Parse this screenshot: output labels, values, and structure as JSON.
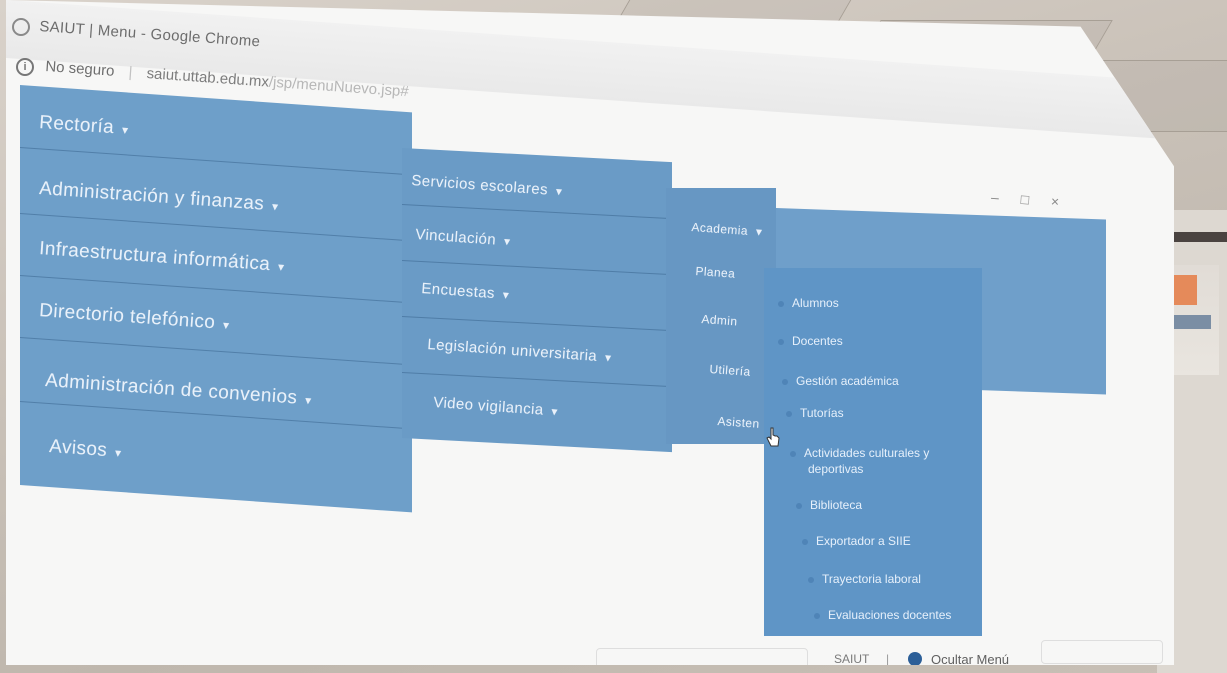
{
  "window": {
    "title": "SAIUT | Menu - Google Chrome",
    "controls": [
      "–",
      "□",
      "×"
    ]
  },
  "address_bar": {
    "insecure_label": "No seguro",
    "separator": "|",
    "host": "saiut.uttab.edu.mx",
    "path": "/jsp/menuNuevo.jsp#"
  },
  "nav_column_1": [
    {
      "label": "Rectoría",
      "caret": "▾"
    },
    {
      "label": "Administración y finanzas",
      "caret": "▾"
    },
    {
      "label": "Infraestructura informática",
      "caret": "▾"
    },
    {
      "label": "Directorio telefónico",
      "caret": "▾"
    },
    {
      "label": "Administración de convenios",
      "caret": "▾"
    },
    {
      "label": "Avisos",
      "caret": "▾"
    }
  ],
  "nav_column_2": [
    {
      "label": "Servicios escolares",
      "caret": "▾"
    },
    {
      "label": "Vinculación",
      "caret": "▾"
    },
    {
      "label": "Encuestas",
      "caret": "▾"
    },
    {
      "label": "Legislación universitaria",
      "caret": "▾"
    },
    {
      "label": "Video vigilancia",
      "caret": "▾"
    }
  ],
  "nav_column_3": [
    {
      "label": "Academia",
      "caret": "▾"
    },
    {
      "label": "Planea"
    },
    {
      "label": "Admin"
    },
    {
      "label": "Utilería"
    },
    {
      "label": "Asisten"
    }
  ],
  "academia_dropdown": [
    "Alumnos",
    "Docentes",
    "Gestión académica",
    "Tutorías",
    "Actividades culturales y",
    "deportivas",
    "Biblioteca",
    "Exportador a SIIE",
    "Trayectoria laboral",
    "Evaluaciones docentes"
  ],
  "status_bar": {
    "app": "SAIUT",
    "separator": "|",
    "hide_menu": "Ocultar Menú"
  },
  "colors": {
    "menu_blue": "#6e9fc9",
    "menu_text": "#e9f1fa"
  }
}
